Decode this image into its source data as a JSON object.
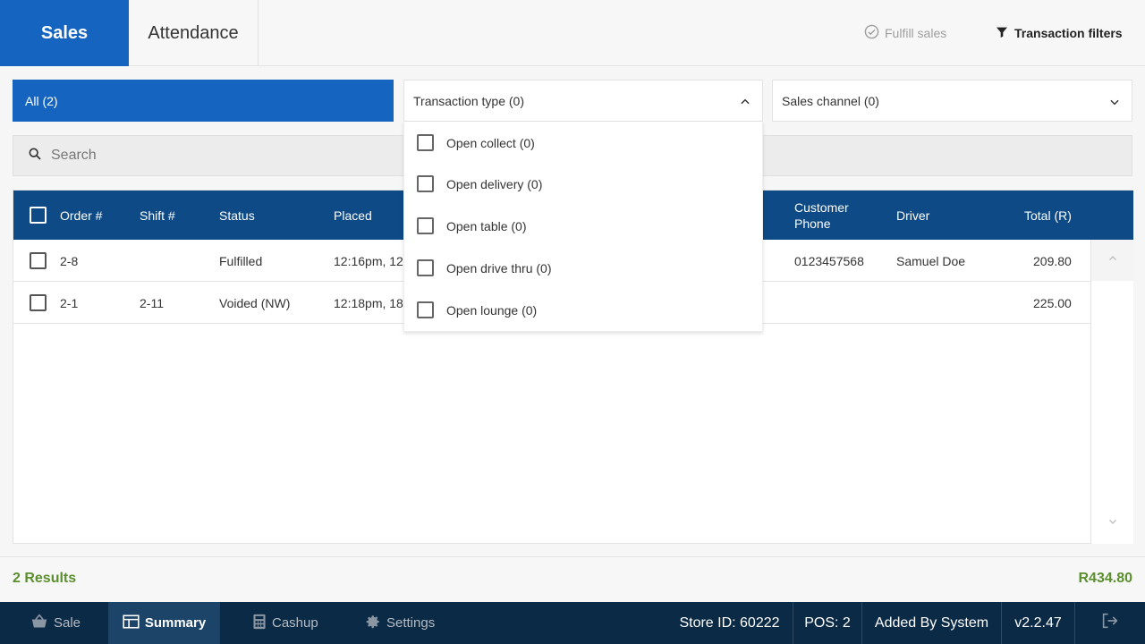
{
  "tabs": {
    "sales": "Sales",
    "attendance": "Attendance"
  },
  "actions": {
    "fulfill": "Fulfill sales",
    "filters": "Transaction filters"
  },
  "filters": {
    "all": "All (2)",
    "transaction_type": "Transaction type (0)",
    "sales_channel": "Sales channel (0)"
  },
  "search": {
    "placeholder": "Search"
  },
  "table": {
    "headers": {
      "order": "Order #",
      "shift": "Shift #",
      "status": "Status",
      "placed": "Placed",
      "phone_1": "Customer",
      "phone_2": "Phone",
      "driver": "Driver",
      "total": "Total (R)"
    },
    "rows": [
      {
        "order": "2-8",
        "shift": "",
        "status": "Fulfilled",
        "placed": "12:16pm, 12",
        "phone": "0123457568",
        "driver": "Samuel Doe",
        "total": "209.80"
      },
      {
        "order": "2-1",
        "shift": "2-11",
        "status": "Voided (NW)",
        "placed": "12:18pm, 18",
        "phone": "",
        "driver": "",
        "total": "225.00"
      }
    ]
  },
  "dropdown": {
    "items": [
      "Open collect (0)",
      "Open delivery (0)",
      "Open table (0)",
      "Open drive thru (0)",
      "Open lounge (0)"
    ]
  },
  "summary": {
    "results": "2 Results",
    "total": "R434.80"
  },
  "bottom": {
    "sale": "Sale",
    "summary": "Summary",
    "cashup": "Cashup",
    "settings": "Settings",
    "store": "Store ID: 60222",
    "pos": "POS: 2",
    "added": "Added By System",
    "version": "v2.2.47"
  },
  "colors": {
    "primary": "#1565c0",
    "header": "#0d4a86",
    "nav": "#0b2a45",
    "accent_green": "#5a8f2d"
  },
  "icons": [
    "check-circle-icon",
    "filter-icon",
    "chevron-down-icon",
    "chevron-up-icon",
    "search-icon",
    "basket-icon",
    "table-icon",
    "calculator-icon",
    "gear-icon",
    "logout-icon"
  ]
}
